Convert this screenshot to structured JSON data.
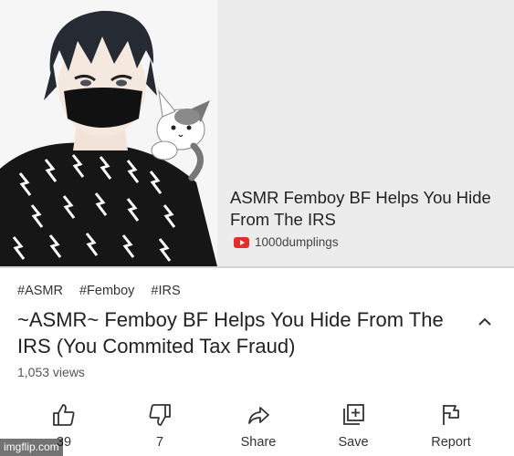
{
  "card": {
    "title": "ASMR Femboy BF Helps You Hide From The IRS",
    "channel": "1000dumplings"
  },
  "tags": [
    "#ASMR",
    "#Femboy",
    "#IRS"
  ],
  "video": {
    "title": "~ASMR~ Femboy BF Helps You Hide From The IRS (You Commited Tax Fraud)",
    "views": "1,053 views"
  },
  "actions": {
    "like": "39",
    "dislike": "7",
    "share": "Share",
    "save": "Save",
    "report": "Report"
  },
  "watermark": "imgflip.com",
  "icons": {
    "like": "thumbs-up-icon",
    "dislike": "thumbs-down-icon",
    "share": "share-arrow-icon",
    "save": "playlist-add-icon",
    "report": "flag-icon",
    "expand": "chevron-up-icon",
    "channel": "youtube-logo-icon"
  },
  "colors": {
    "brand": "#e52d27",
    "card_bg": "#ececec"
  }
}
